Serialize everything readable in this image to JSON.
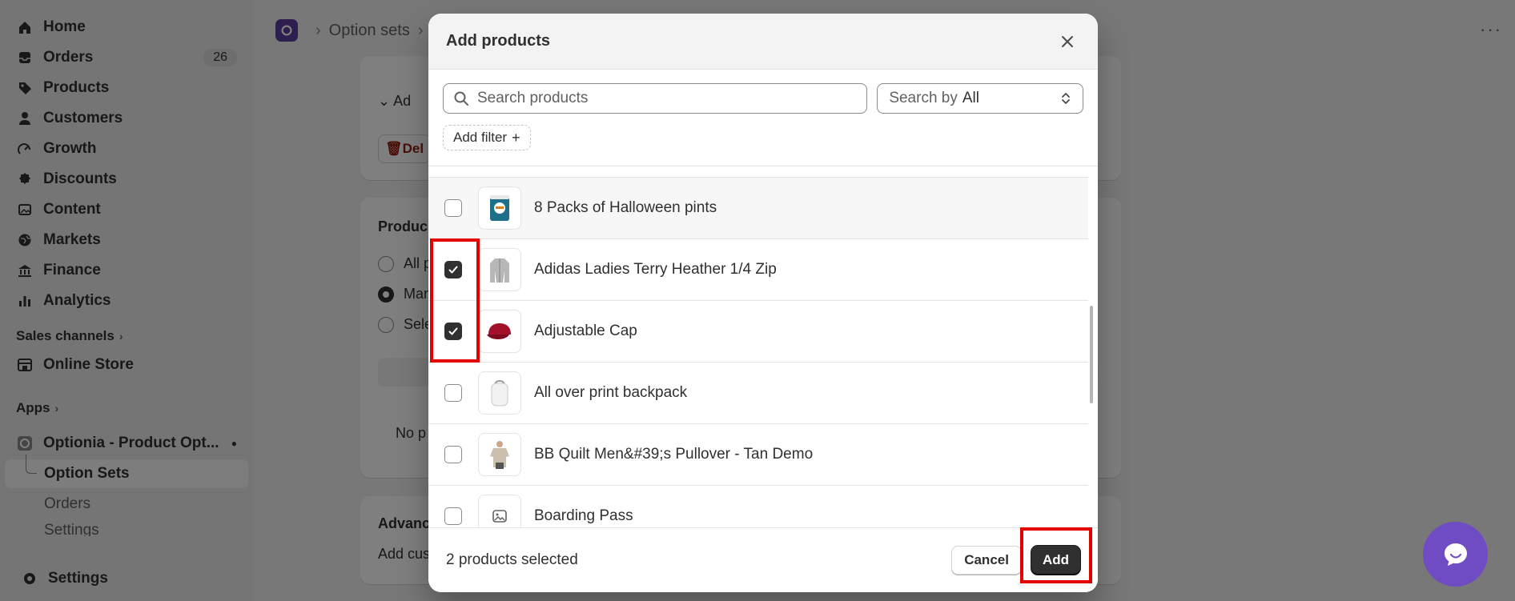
{
  "sidebar": {
    "items": [
      {
        "label": "Home",
        "icon": "home-icon"
      },
      {
        "label": "Orders",
        "icon": "orders-icon",
        "badge": "26"
      },
      {
        "label": "Products",
        "icon": "tag-icon"
      },
      {
        "label": "Customers",
        "icon": "person-icon"
      },
      {
        "label": "Growth",
        "icon": "growth-icon"
      },
      {
        "label": "Discounts",
        "icon": "discount-icon"
      },
      {
        "label": "Content",
        "icon": "content-icon"
      },
      {
        "label": "Markets",
        "icon": "globe-icon"
      },
      {
        "label": "Finance",
        "icon": "bank-icon"
      },
      {
        "label": "Analytics",
        "icon": "chart-icon"
      }
    ],
    "sales_channels_label": "Sales channels",
    "online_store_label": "Online Store",
    "apps_label": "Apps",
    "app_name": "Optionia - Product Opt...",
    "sub_items": [
      "Option Sets",
      "Orders",
      "Settings"
    ],
    "settings_label": "Settings"
  },
  "page": {
    "breadcrumb_parent": "Option sets",
    "breadcrumb_current": "C",
    "bg_fragments": {
      "add_link": "Ad",
      "delete_btn": "Del",
      "products_heading": "Produc",
      "radio_all": "All p",
      "radio_manual": "Man",
      "radio_select": "Sele",
      "no_products": "No p",
      "advanced_heading": "Advanc",
      "advanced_text": "Add cus"
    }
  },
  "modal": {
    "title": "Add products",
    "search_placeholder": "Search products",
    "search_by_label": "Search by",
    "search_by_value": "All",
    "add_filter_label": "Add filter",
    "products": [
      {
        "title": "8 Packs of Halloween pints",
        "checked": false,
        "thumb": "pint-container-icon"
      },
      {
        "title": "Adidas Ladies Terry Heather 1/4 Zip",
        "checked": true,
        "thumb": "jacket-icon"
      },
      {
        "title": "Adjustable Cap",
        "checked": true,
        "thumb": "cap-icon"
      },
      {
        "title": "All over print backpack",
        "checked": false,
        "thumb": "backpack-icon"
      },
      {
        "title": "BB Quilt Men&#39;s Pullover - Tan Demo",
        "checked": false,
        "thumb": "pullover-icon"
      },
      {
        "title": "Boarding Pass",
        "checked": false,
        "thumb": "image-placeholder-icon"
      }
    ],
    "selected_count_text": "2 products selected",
    "cancel_label": "Cancel",
    "add_label": "Add"
  },
  "colors": {
    "highlight": "#e50000",
    "primary_button": "#303030",
    "chat_bubble": "#6f4bc4",
    "app_logo": "#5c3b9e"
  }
}
